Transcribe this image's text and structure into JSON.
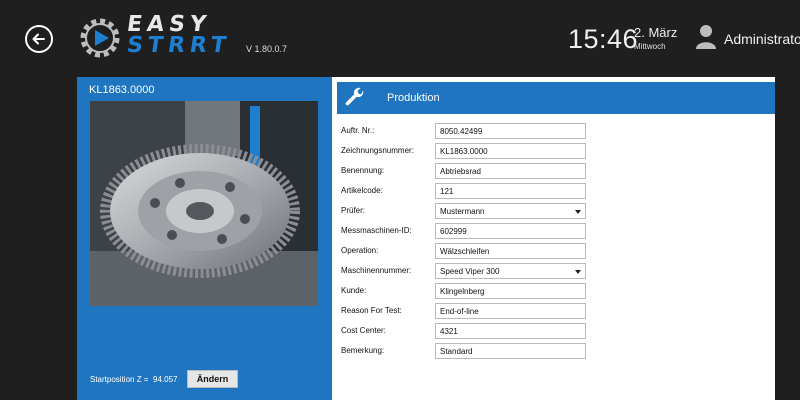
{
  "header": {
    "logo_line1": "EASY",
    "logo_line2": "STRRT",
    "version": "V 1.80.0.7",
    "time": "15:46",
    "date": "2. März",
    "weekday": "Mittwoch",
    "user": "Administrator"
  },
  "left_panel": {
    "part_number": "KL1863.0000",
    "startpos_label": "Startposition Z =",
    "startpos_value": "94.057",
    "change_button": "Ändern"
  },
  "form": {
    "title": "Produktion",
    "rows": [
      {
        "label": "Auftr. Nr.:",
        "value": "8050.42499",
        "dropdown": false
      },
      {
        "label": "Zeichnungsnummer:",
        "value": "KL1863.0000",
        "dropdown": false
      },
      {
        "label": "Benennung:",
        "value": "Abtriebsrad",
        "dropdown": false
      },
      {
        "label": "Artikelcode:",
        "value": "121",
        "dropdown": false
      },
      {
        "label": "Prüfer:",
        "value": "Mustermann",
        "dropdown": true
      },
      {
        "label": "Messmaschinen-ID:",
        "value": "602999",
        "dropdown": false
      },
      {
        "label": "Operation:",
        "value": "Wälzschleifen",
        "dropdown": false
      },
      {
        "label": "Maschinennummer:",
        "value": "Speed Viper 300",
        "dropdown": true
      },
      {
        "label": "Kunde:",
        "value": "Klingelnberg",
        "dropdown": false
      },
      {
        "label": "Reason For Test:",
        "value": "End-of-line",
        "dropdown": false
      },
      {
        "label": "Cost Center:",
        "value": "4321",
        "dropdown": false
      },
      {
        "label": "Bemerkung:",
        "value": "Standard",
        "dropdown": false
      }
    ]
  },
  "colors": {
    "accent": "#1f75bf",
    "background": "#1f1f1f"
  }
}
